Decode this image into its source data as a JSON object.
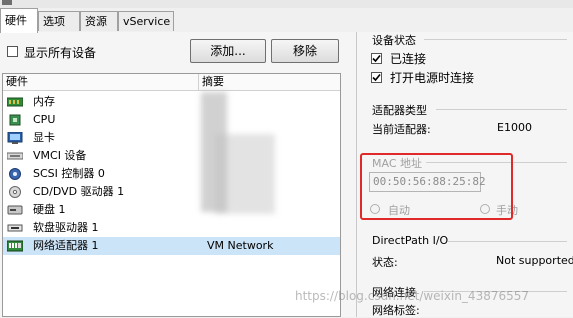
{
  "tabs": [
    {
      "label": "硬件",
      "active": true
    },
    {
      "label": "选项",
      "active": false
    },
    {
      "label": "资源",
      "active": false
    },
    {
      "label": "vService",
      "active": false
    }
  ],
  "left": {
    "show_all_label": "显示所有设备",
    "show_all_checked": false,
    "add_button": "添加...",
    "remove_button": "移除",
    "col_hardware": "硬件",
    "col_summary": "摘要",
    "rows": [
      {
        "name": "内存",
        "summary": "",
        "icon": "memory-icon"
      },
      {
        "name": "CPU",
        "summary": "",
        "icon": "cpu-icon"
      },
      {
        "name": "显卡",
        "summary": "",
        "icon": "display-card-icon"
      },
      {
        "name": "VMCI 设备",
        "summary": "",
        "icon": "vmci-device-icon"
      },
      {
        "name": "SCSI 控制器 0",
        "summary": "",
        "icon": "scsi-controller-icon"
      },
      {
        "name": "CD/DVD 驱动器 1",
        "summary": "",
        "icon": "cd-dvd-icon"
      },
      {
        "name": "硬盘 1",
        "summary": "",
        "icon": "hard-disk-icon"
      },
      {
        "name": "软盘驱动器 1",
        "summary": "",
        "icon": "floppy-icon"
      },
      {
        "name": "网络适配器 1",
        "summary": "VM Network",
        "icon": "network-adapter-icon",
        "selected": true
      }
    ]
  },
  "right": {
    "device_status_title": "设备状态",
    "connected_label": "已连接",
    "connected_checked": true,
    "connect_at_power_on_label": "打开电源时连接",
    "connect_at_power_on_checked": true,
    "adapter_type_title": "适配器类型",
    "current_adapter_label": "当前适配器:",
    "current_adapter_value": "E1000",
    "mac_title": "MAC 地址",
    "mac_value": "00:50:56:88:25:82",
    "auto_label": "自动",
    "manual_label": "手动",
    "directpath_title": "DirectPath I/O",
    "status_label": "状态:",
    "status_value": "Not supported",
    "network_connection_title": "网络连接",
    "network_label_label": "网络标签:"
  },
  "watermark": "https://blog.csdn.net/weixin_43876557",
  "colors": {
    "selection": "#cce4f7",
    "highlight_box": "#e02a2a"
  }
}
